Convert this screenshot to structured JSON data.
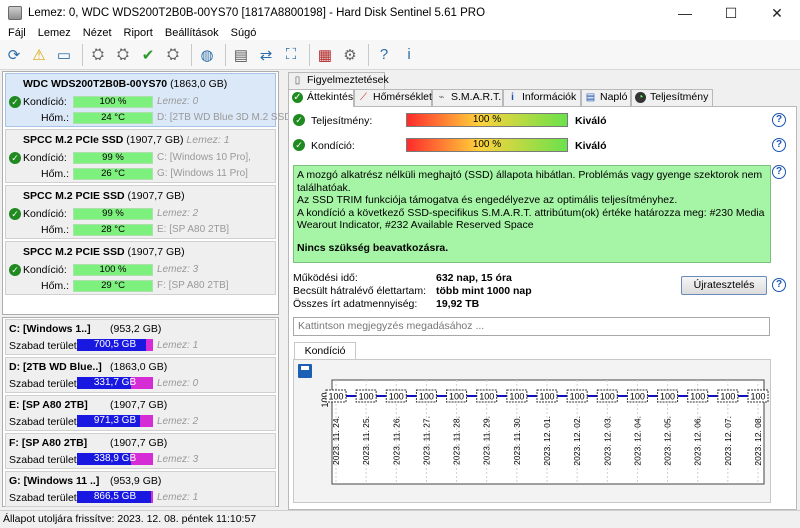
{
  "window": {
    "title": "Lemez: 0, WDC WDS200T2B0B-00YS70 [1817A8800198]  -  Hard Disk Sentinel 5.61 PRO",
    "minimize": "—",
    "maximize": "☐",
    "close": "✕"
  },
  "menu": [
    "Fájl",
    "Lemez",
    "Nézet",
    "Riport",
    "Beállítások",
    "Súgó"
  ],
  "disks": [
    {
      "name": "WDC WDS200T2B0B-00YS70",
      "capacity": "(1863,0 GB)",
      "condition_label": "Kondíció:",
      "condition": "100 %",
      "disk_no": "Lemez: 0",
      "temp_label": "Hőm.:",
      "temp": "24 °C",
      "volume": "D: [2TB WD Blue 3D M.2 SSD]"
    },
    {
      "name": "SPCC M.2 PCIe SSD",
      "capacity": "(1907,7 GB)",
      "disk_no_inline": "Lemez: 1",
      "condition_label": "Kondíció:",
      "condition": "99 %",
      "vol1": "C: [Windows 10 Pro],",
      "temp_label": "Hőm.:",
      "temp": "26 °C",
      "vol2": "G: [Windows 11 Pro]"
    },
    {
      "name": "SPCC M.2 PCIE SSD",
      "capacity": "(1907,7 GB)",
      "condition_label": "Kondíció:",
      "condition": "99 %",
      "disk_no": "Lemez: 2",
      "temp_label": "Hőm.:",
      "temp": "28 °C",
      "volume": "E: [SP A80 2TB]"
    },
    {
      "name": "SPCC M.2 PCIE SSD",
      "capacity": "(1907,7 GB)",
      "condition_label": "Kondíció:",
      "condition": "100 %",
      "disk_no": "Lemez: 3",
      "temp_label": "Hőm.:",
      "temp": "29 °C",
      "volume": "F: [SP A80 2TB]"
    }
  ],
  "volumes": [
    {
      "name": "C: [Windows 1..]",
      "capacity": "(953,2 GB)",
      "free_label": "Szabad terület",
      "free": "700,5 GB",
      "free_fraction": 0.735,
      "disk": "Lemez: 1"
    },
    {
      "name": "D: [2TB WD Blue..]",
      "capacity": "(1863,0 GB)",
      "free_label": "Szabad terület",
      "free": "331,7 GB",
      "free_fraction": 0.178,
      "disk": "Lemez: 0"
    },
    {
      "name": "E: [SP A80 2TB]",
      "capacity": "(1907,7 GB)",
      "free_label": "Szabad terület",
      "free": "971,3 GB",
      "free_fraction": 0.509,
      "disk": "Lemez: 2"
    },
    {
      "name": "F: [SP A80 2TB]",
      "capacity": "(1907,7 GB)",
      "free_label": "Szabad terület",
      "free": "338,9 GB",
      "free_fraction": 0.178,
      "disk": "Lemez: 3"
    },
    {
      "name": "G: [Windows 11 ..]",
      "capacity": "(953,9 GB)",
      "free_label": "Szabad terület",
      "free": "866,5 GB",
      "free_fraction": 0.908,
      "disk": "Lemez: 1"
    }
  ],
  "tabs_row1": [
    "Figyelmeztetések"
  ],
  "tabs_row2": [
    "Áttekintés",
    "Hőmérséklet",
    "S.M.A.R.T.",
    "Információk",
    "Napló",
    "Teljesítmény"
  ],
  "overview": {
    "performance_label": "Teljesítmény:",
    "performance_value": "100 %",
    "performance_status": "Kiváló",
    "condition_label": "Kondíció:",
    "condition_value": "100 %",
    "condition_status": "Kiváló",
    "message_lines": [
      "A mozgó alkatrész nélküli meghajtó (SSD) állapota hibátlan. Problémás vagy gyenge szektorok nem találhatóak.",
      "Az SSD TRIM funkciója támogatva és engedélyezve az optimális teljesítményhez.",
      "A kondíció a következő SSD-specifikus S.M.A.R.T. attribútum(ok) értéke határozza meg:  #230 Media Wearout Indicator, #232 Available Reserved Space"
    ],
    "message_final": "Nincs szükség beavatkozásra.",
    "uptime_label": "Működési idő:",
    "uptime_value": "632 nap, 15 óra",
    "lifetime_label": "Becsült hátralévő élettartam:",
    "lifetime_value": "több mint 1000 nap",
    "written_label": "Összes írt adatmennyiség:",
    "written_value": "19,92 TB",
    "retest_button": "Újratesztelés",
    "note_placeholder": "Kattintson megjegyzés megadásához ...",
    "chart_tab": "Kondíció  (%)"
  },
  "chart_data": {
    "type": "line",
    "x": [
      "2023. 11. 24.",
      "2023. 11. 25.",
      "2023. 11. 26.",
      "2023. 11. 27.",
      "2023. 11. 28.",
      "2023. 11. 29.",
      "2023. 11. 30.",
      "2023. 12. 01.",
      "2023. 12. 02.",
      "2023. 12. 03.",
      "2023. 12. 04.",
      "2023. 12. 05.",
      "2023. 12. 06.",
      "2023. 12. 07.",
      "2023. 12. 08."
    ],
    "values": [
      100,
      100,
      100,
      100,
      100,
      100,
      100,
      100,
      100,
      100,
      100,
      100,
      100,
      100,
      100
    ],
    "y_tick": "100",
    "color": "#1010c0"
  },
  "status": "Állapot utoljára frissítve: 2023. 12. 08. péntek 11:10:57",
  "colors": {
    "selected_disk": "#dbe8f7",
    "good_bar": "#7df07d",
    "message_bg": "#a6f5a6",
    "volume_used": "#1818e0",
    "volume_free": "#d62cd6"
  }
}
